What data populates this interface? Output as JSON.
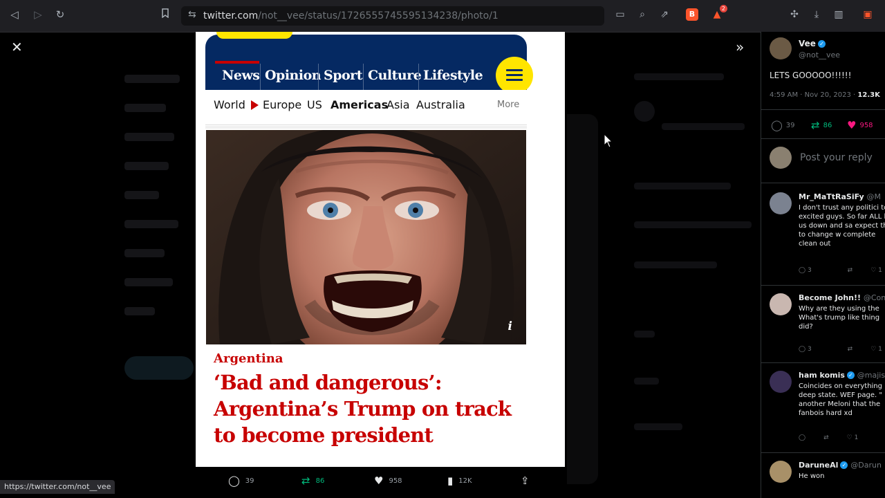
{
  "browser": {
    "url_host": "twitter.com",
    "url_path": "/not__vee/status/1726555745595134238/photo/1",
    "status_url": "https://twitter.com/not__vee",
    "brave_badge": "",
    "alert_badge": "2"
  },
  "article": {
    "nav": [
      "News",
      "Opinion",
      "Sport",
      "Culture",
      "Lifestyle"
    ],
    "subnav": [
      "World",
      "Europe",
      "US",
      "Americas",
      "Asia",
      "Australia"
    ],
    "more": "More",
    "info": "i",
    "kicker": "Argentina",
    "headline": "‘Bad and dangerous’: Argentina’s Trump on track to become president"
  },
  "photo_actions": {
    "replies": "39",
    "retweets": "86",
    "likes": "958",
    "views": "12K"
  },
  "tweet": {
    "author": "Vee",
    "handle": "@not__vee",
    "text": "LETS GOOOOO!!!!!!",
    "time": "4:59 AM · Nov 20, 2023 ·",
    "views": "12.3K",
    "replies": "39",
    "retweets": "86",
    "likes": "958",
    "reply_placeholder": "Post your reply"
  },
  "replies": [
    {
      "name": "Mr_MaTtRaSiFy",
      "handle": "@M",
      "text": "I don't trust any politici too excited guys. So far ALL let us down and sa expect that to change w complete clean out",
      "replies": "3",
      "retweets": "",
      "likes": "1"
    },
    {
      "name": "Become John!!",
      "handle": "@Cone",
      "text": "Why are they using the What's trump like thing did?",
      "replies": "3",
      "retweets": "",
      "likes": "1"
    },
    {
      "name": "ham komis",
      "handle": "@majis",
      "text": "Coincides on everything deep state. WEF page. \" another Meloni that the fanbois hard xd",
      "replies": "",
      "retweets": "",
      "likes": "1"
    },
    {
      "name": "DaruneAl",
      "handle": "@Darun",
      "text": "He won",
      "replies": "",
      "retweets": "",
      "likes": ""
    }
  ]
}
